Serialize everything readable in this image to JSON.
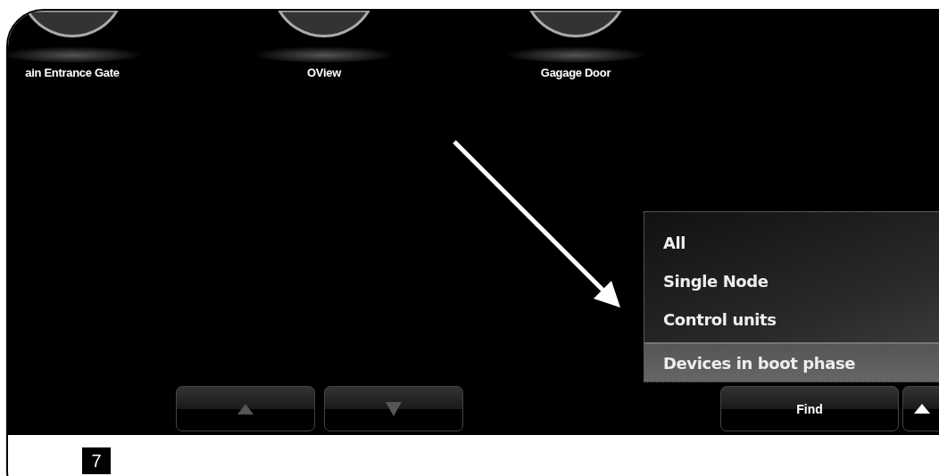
{
  "devices": [
    {
      "label": "ain Entrance Gate"
    },
    {
      "label": "OView"
    },
    {
      "label": "Gagage Door"
    }
  ],
  "menu": {
    "items": [
      {
        "label": "All",
        "selected": false
      },
      {
        "label": "Single Node",
        "selected": false
      },
      {
        "label": "Control units",
        "selected": false
      },
      {
        "label": "Devices in boot phase",
        "selected": true
      }
    ]
  },
  "scroll_buttons": [
    {
      "kind": "up"
    },
    {
      "kind": "down"
    }
  ],
  "find_button": {
    "label": "Find"
  },
  "figure_number": "7"
}
